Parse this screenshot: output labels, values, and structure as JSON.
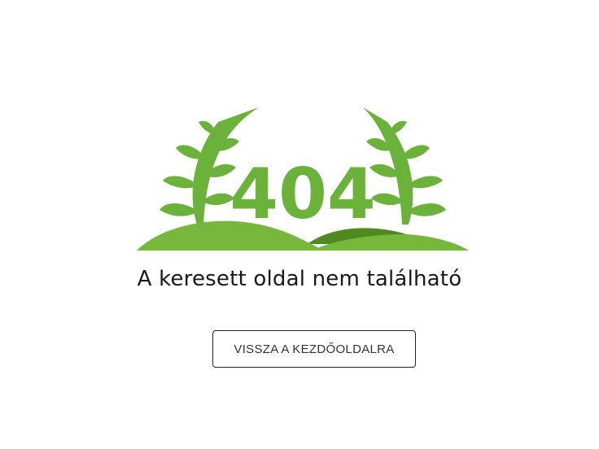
{
  "error": {
    "code": "404",
    "message": "A keresett oldal nem található"
  },
  "actions": {
    "home_label": "VISSZA A KEZDŐOLDALRA"
  },
  "colors": {
    "leaf_green": "#6ab23a",
    "hill_light": "#75b83c",
    "hill_dark": "#4e8a1f",
    "code_green": "#6ab23a",
    "text": "#1a1a1a",
    "button_border": "#222222"
  },
  "icons": {
    "left_branch": "laurel-branch-icon",
    "right_branch": "laurel-branch-icon"
  }
}
